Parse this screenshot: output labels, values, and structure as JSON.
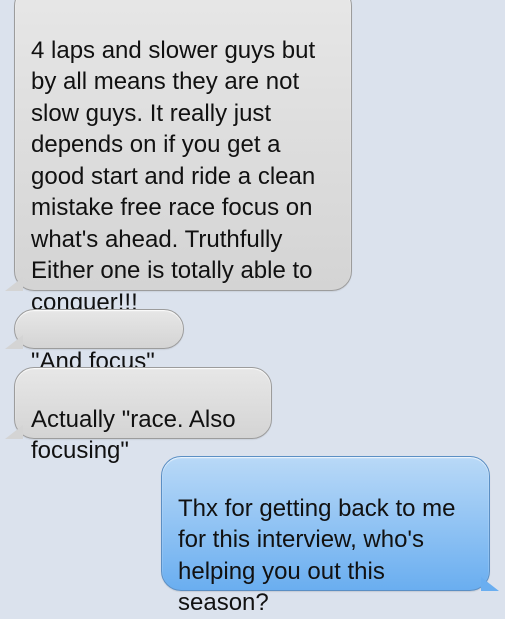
{
  "conversation": {
    "messages": [
      {
        "direction": "received",
        "text": "4 laps and slower guys but\nby all means they are not\nslow guys. It really just\ndepends on if you get a\ngood start and ride a clean\nmistake free race focus on\nwhat's ahead. Truthfully\nEither one is totally able to\nconquer!!!"
      },
      {
        "direction": "received",
        "text": "\"And focus\""
      },
      {
        "direction": "received",
        "text": "Actually \"race. Also\nfocusing\""
      },
      {
        "direction": "sent",
        "text": "Thx for getting back to me\nfor this interview, who's\nhelping you out this\nseason?"
      }
    ]
  },
  "colors": {
    "background": "#dbe2ed",
    "received_bubble": "#d4d4d4",
    "sent_bubble": "#6aaef0"
  }
}
